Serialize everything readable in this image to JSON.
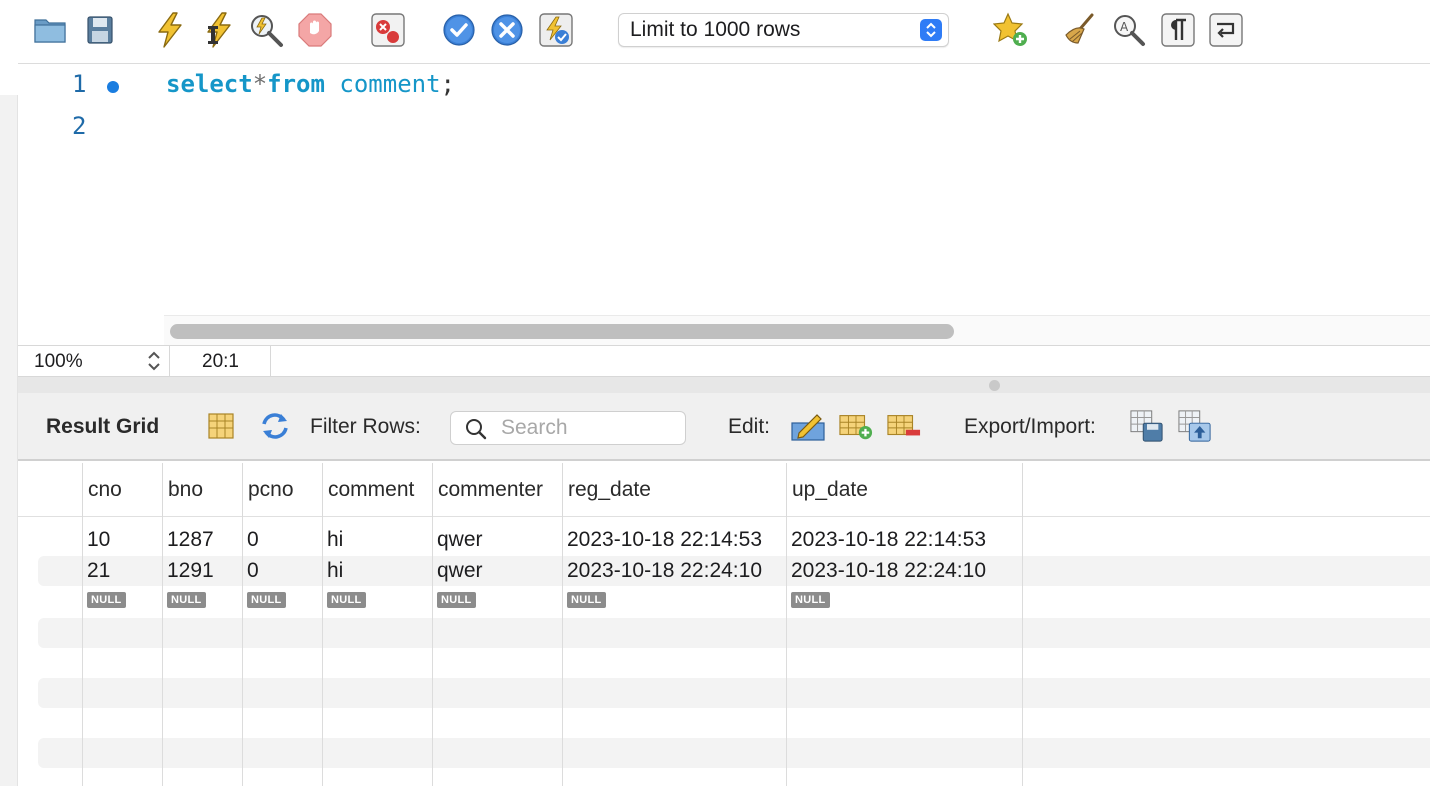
{
  "toolbar": {
    "limit_select_value": "Limit to 1000 rows",
    "icons": [
      "folder-icon",
      "save-icon",
      "execute-icon",
      "execute-current-icon",
      "explain-icon",
      "stop-icon",
      "toggle-error-icon",
      "commit-icon",
      "rollback-icon",
      "autocommit-icon",
      "add-snippet-icon",
      "beautify-icon",
      "find-icon",
      "invisible-chars-icon",
      "wrap-lines-icon"
    ]
  },
  "editor": {
    "lines": [
      {
        "number": "1",
        "tokens": [
          {
            "t": "select",
            "c": "kw"
          },
          {
            "t": "*",
            "c": "op"
          },
          {
            "t": "from",
            "c": "kw"
          },
          {
            "t": " comment",
            "c": "ident"
          },
          {
            "t": ";",
            "c": "punc"
          }
        ]
      },
      {
        "number": "2",
        "tokens": []
      }
    ]
  },
  "statusbar": {
    "zoom": "100%",
    "cursor_position": "20:1"
  },
  "result": {
    "title": "Result Grid",
    "filter_label": "Filter Rows:",
    "search_placeholder": "Search",
    "edit_label": "Edit:",
    "export_label": "Export/Import:"
  },
  "grid": {
    "columns": [
      "cno",
      "bno",
      "pcno",
      "comment",
      "commenter",
      "reg_date",
      "up_date"
    ],
    "rows": [
      [
        "10",
        "1287",
        "0",
        "hi",
        "qwer",
        "2023-10-18 22:14:53",
        "2023-10-18 22:14:53"
      ],
      [
        "21",
        "1291",
        "0",
        "hi",
        "qwer",
        "2023-10-18 22:24:10",
        "2023-10-18 22:24:10"
      ]
    ],
    "null_label": "NULL"
  },
  "colors": {
    "keyword": "#1596c8",
    "accent": "#2f7cf6",
    "line_number": "#1e6aa8"
  }
}
